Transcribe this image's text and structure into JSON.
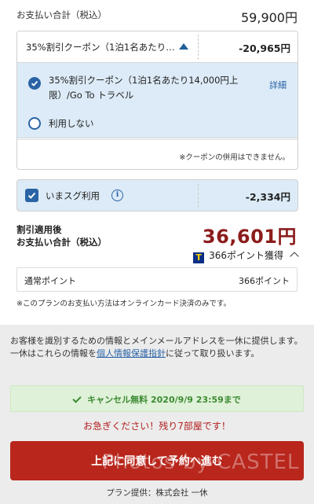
{
  "summary": {
    "total_label": "お支払い合計（税込）",
    "total_value": "59,900円"
  },
  "coupon": {
    "header_label": "35%割引クーポン（1泊1名あたり…",
    "header_amount": "-20,965円",
    "option_selected_text": "35%割引クーポン（1泊1名あたり14,000円上限）/Go To トラベル",
    "detail_label": "詳細",
    "option_none_label": "利用しない",
    "note": "※クーポンの併用はできません。"
  },
  "imasugu": {
    "label": "いまスグ利用",
    "info_glyph": "i",
    "amount": "-2,334円",
    "checked": true
  },
  "after_discount": {
    "label_line1": "割引適用後",
    "label_line2": "お支払い合計（税込）",
    "amount": "36,601円",
    "points_badge": "T",
    "points_text": "366ポイント獲得"
  },
  "normal_points": {
    "label": "通常ポイント",
    "value": "366ポイント"
  },
  "payment_note": "※このプランのお支払い方法はオンラインカード決済のみです。",
  "privacy": {
    "text_before": "お客様を識別するための情報とメインメールアドレスを一休に提供します。一休はこれらの情報を",
    "link": "個人情報保護指針",
    "text_after": "に従って取り扱います。"
  },
  "cancel": {
    "text": "キャンセル無料 2020/9/9 23:59まで"
  },
  "hurry_text": "お急ぎください！残り7部屋です！",
  "reserve_button_label": "上記に同意して予約へ進む",
  "watermark": "Photos by CASTEL",
  "provider_text": "プラン提供：株式会社 一休",
  "colors": {
    "accent_blue": "#2a63a6",
    "discount_red": "#8c1c1c",
    "button_red": "#b8261c",
    "cancel_green": "#3c8a32",
    "selected_bg": "#dcebf7"
  }
}
